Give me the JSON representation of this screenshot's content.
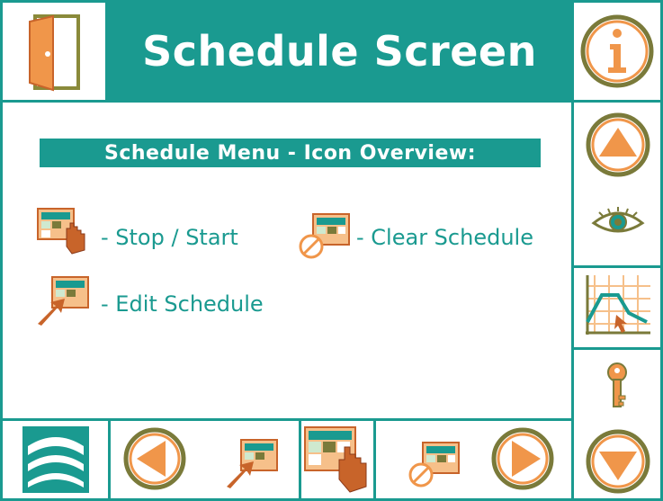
{
  "header": {
    "title": "Schedule Screen"
  },
  "menu": {
    "heading": "Schedule Menu - Icon Overview:",
    "legend": [
      {
        "icon": "hand-schedule-icon",
        "label": "- Stop / Start"
      },
      {
        "icon": "clear-schedule-icon",
        "label": "- Clear Schedule"
      },
      {
        "icon": "edit-schedule-icon",
        "label": "- Edit Schedule"
      }
    ]
  },
  "right_panel": {
    "icons": [
      "info-icon",
      "up-arrow-icon",
      "eye-icon",
      "graph-icon",
      "key-icon",
      "down-arrow-icon"
    ]
  },
  "bottom_bar": {
    "icons": [
      "logo-icon",
      "left-arrow-icon",
      "edit-schedule-icon",
      "stop-start-schedule-icon",
      "clear-schedule-icon",
      "right-arrow-icon"
    ]
  },
  "colors": {
    "teal": "#1a9a90",
    "orange": "#f0964a",
    "dark_orange": "#c8642a",
    "olive": "#7a7a3a"
  }
}
